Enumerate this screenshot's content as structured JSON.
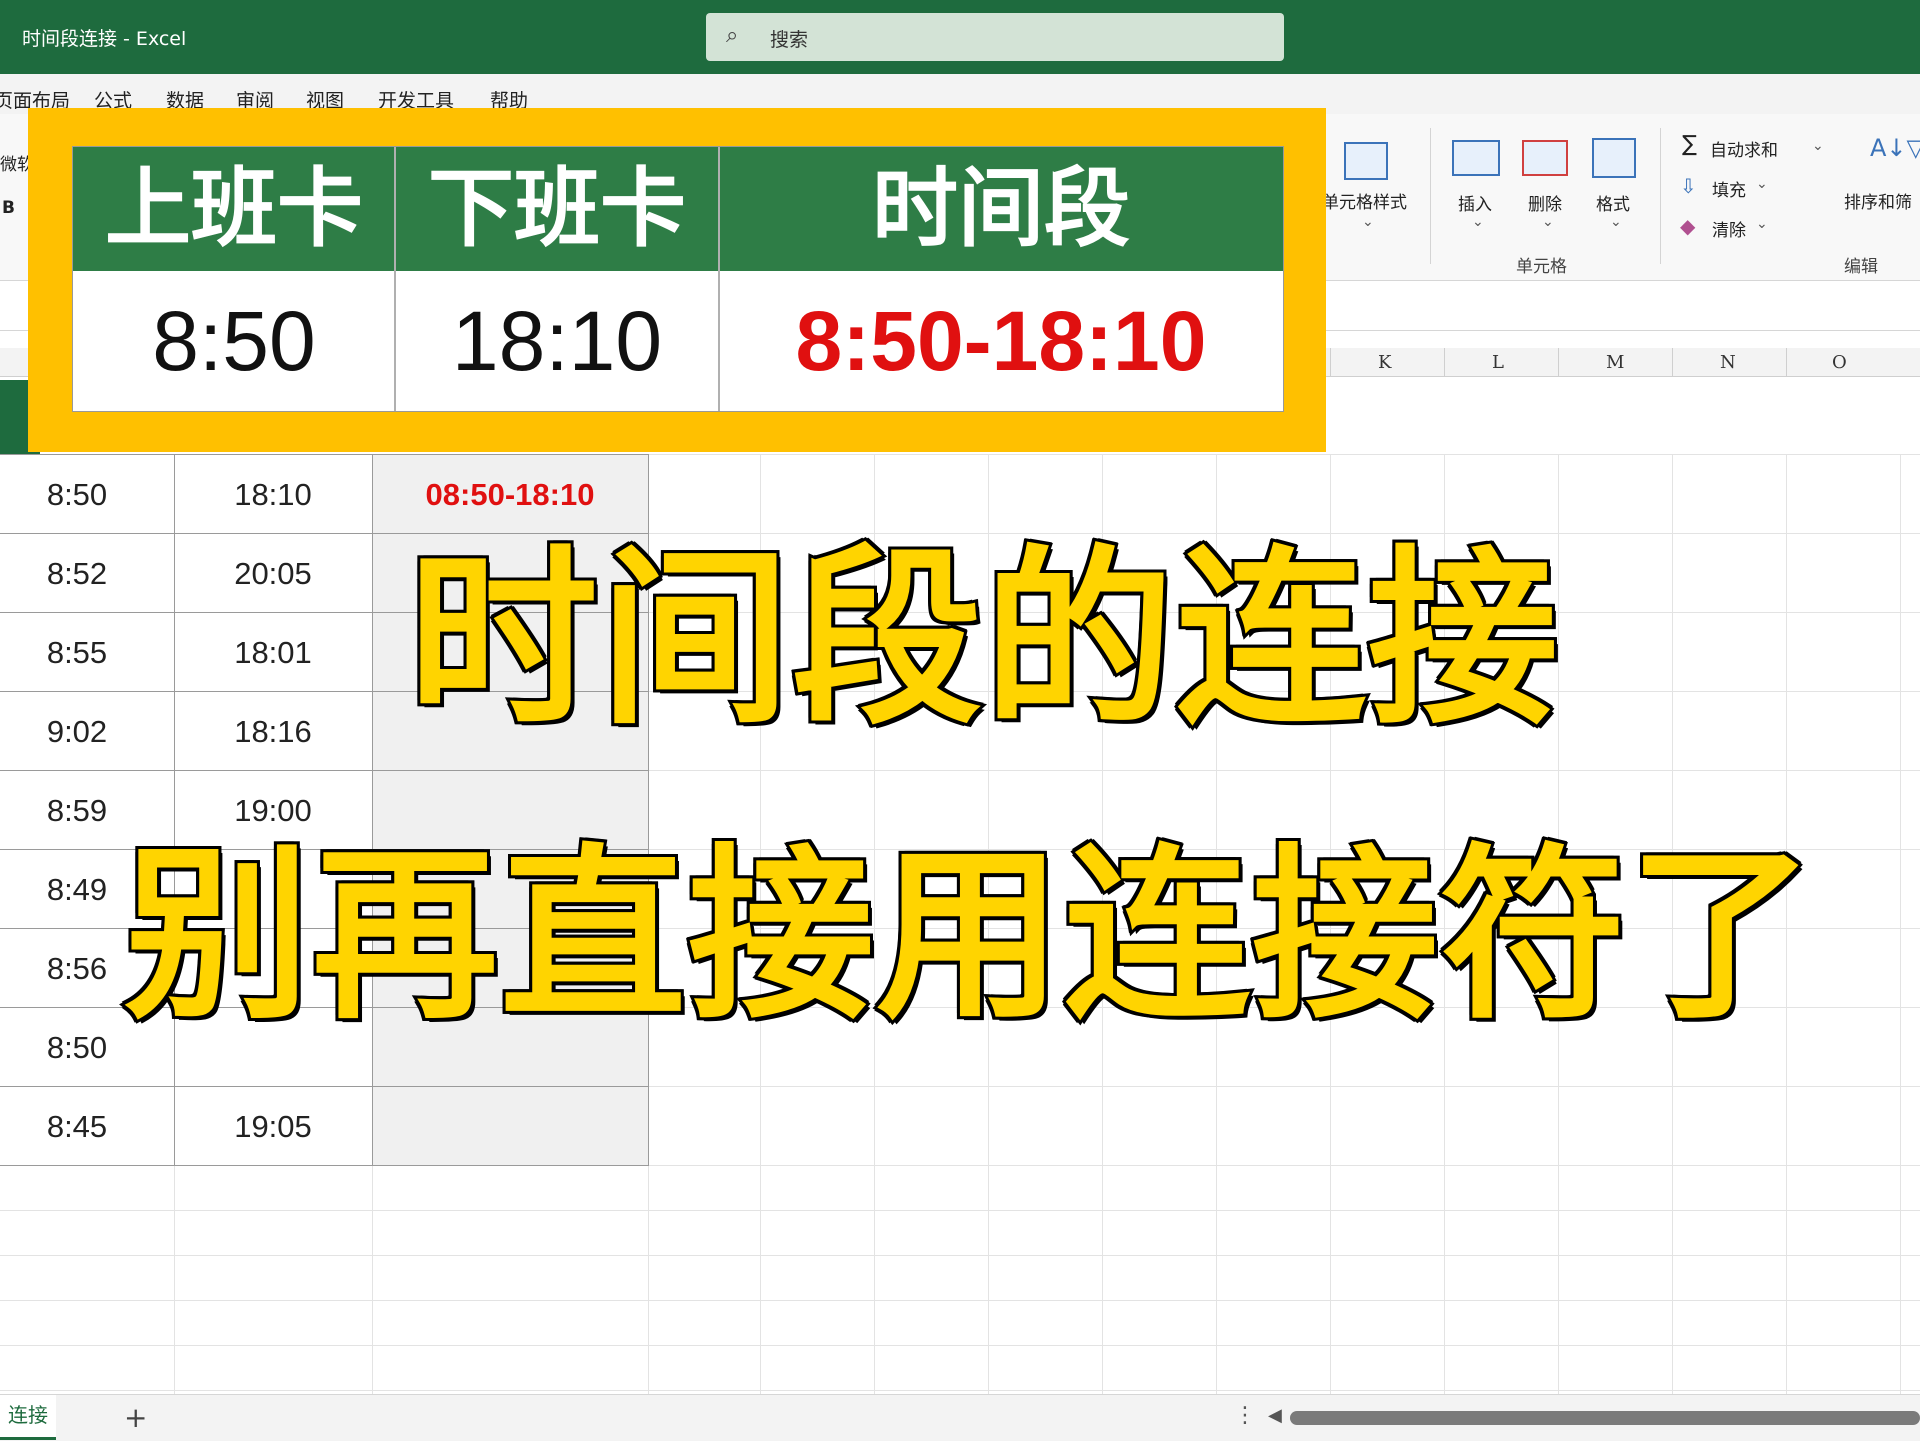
{
  "window": {
    "title": "时间段连接  -  Excel"
  },
  "search": {
    "placeholder": "搜索"
  },
  "menu": [
    "页面布局",
    "公式",
    "数据",
    "审阅",
    "视图",
    "开发工具",
    "帮助"
  ],
  "ribbon": {
    "font_fragment": "微软",
    "bold_label": "B",
    "cell_styles": "单元格样式",
    "insert": "插入",
    "delete": "删除",
    "format": "格式",
    "cells_group": "单元格",
    "autosum": "自动求和",
    "fill": "填充",
    "clear": "清除",
    "sort_filter": "排序和筛",
    "editing_group": "编辑"
  },
  "columns": [
    "K",
    "L",
    "M",
    "N",
    "O"
  ],
  "overlay": {
    "headers": [
      "上班卡",
      "下班卡",
      "时间段"
    ],
    "values": [
      "8:50",
      "18:10",
      "8:50-18:10"
    ]
  },
  "table": {
    "rows": [
      {
        "start": "8:50",
        "end": "18:10",
        "result": "08:50-18:10"
      },
      {
        "start": "8:52",
        "end": "20:05",
        "result": ""
      },
      {
        "start": "8:55",
        "end": "18:01",
        "result": ""
      },
      {
        "start": "9:02",
        "end": "18:16",
        "result": ""
      },
      {
        "start": "8:59",
        "end": "19:00",
        "result": ""
      },
      {
        "start": "8:49",
        "end": "",
        "result": ""
      },
      {
        "start": "8:56",
        "end": "",
        "result": ""
      },
      {
        "start": "8:50",
        "end": "",
        "result": ""
      },
      {
        "start": "8:45",
        "end": "19:05",
        "result": ""
      }
    ]
  },
  "caption": {
    "line1": "时间段的连接",
    "line2": "别再直接用连接符了"
  },
  "sheet": {
    "tab": "连接",
    "add": "+"
  }
}
